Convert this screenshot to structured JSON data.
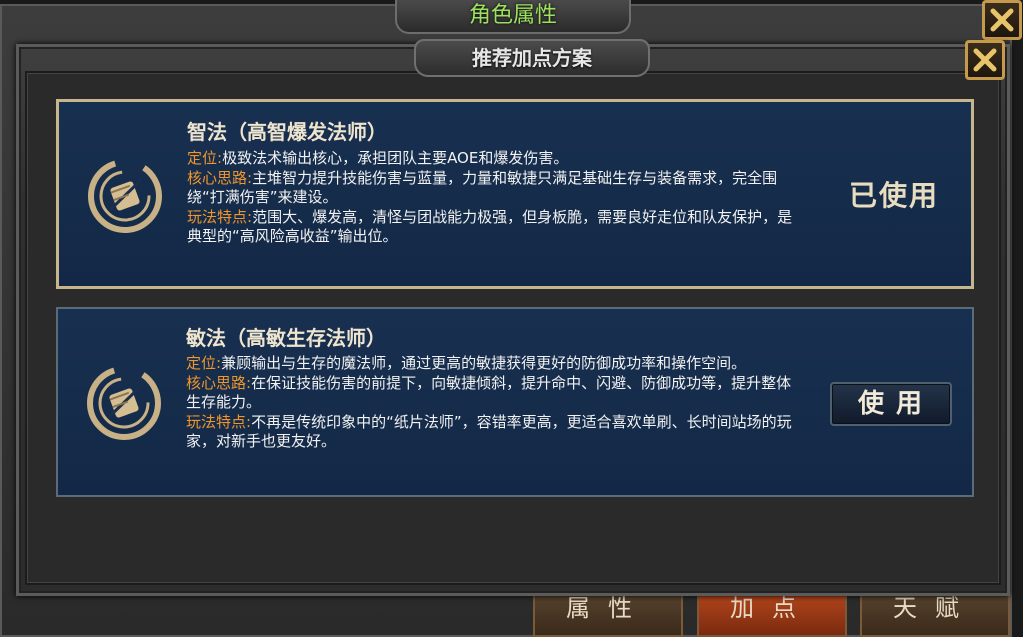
{
  "outer_window": {
    "title": "角色属性",
    "bottom_tabs": [
      {
        "label": "属性"
      },
      {
        "label": "加点"
      },
      {
        "label": "天赋"
      }
    ]
  },
  "dialog": {
    "title": "推荐加点方案",
    "plans": [
      {
        "title": "智法（高智爆发法师）",
        "positioning_label": "定位:",
        "positioning_text": "极致法术输出核心，承担团队主要AOE和爆发伤害。",
        "core_label": "核心思路:",
        "core_text": "主堆智力提升技能伤害与蓝量，力量和敏捷只满足基础生存与装备需求，完全围绕“打满伤害”来建设。",
        "features_label": "玩法特点:",
        "features_text": "范围大、爆发高，清怪与团战能力极强，但身板脆，需要良好走位和队友保护，是典型的“高风险高收益”输出位。",
        "status": "已使用"
      },
      {
        "title": "敏法（高敏生存法师）",
        "positioning_label": "定位:",
        "positioning_text": "兼顾输出与生存的魔法师，通过更高的敏捷获得更好的防御成功率和操作空间。",
        "core_label": "核心思路:",
        "core_text": "在保证技能伤害的前提下，向敏捷倾斜，提升命中、闪避、防御成功等，提升整体生存能力。",
        "features_label": "玩法特点:",
        "features_text": "不再是传统印象中的“纸片法师”，容错率更高，更适合喜欢单刷、长时间站场的玩家，对新手也更友好。",
        "button": "使用"
      }
    ]
  },
  "colors": {
    "outer_title": "#9de25c",
    "label_orange": "#f0962d",
    "card_bg": "#183050",
    "selected_border": "#c7b68c",
    "close_border": "#c59a4c"
  }
}
